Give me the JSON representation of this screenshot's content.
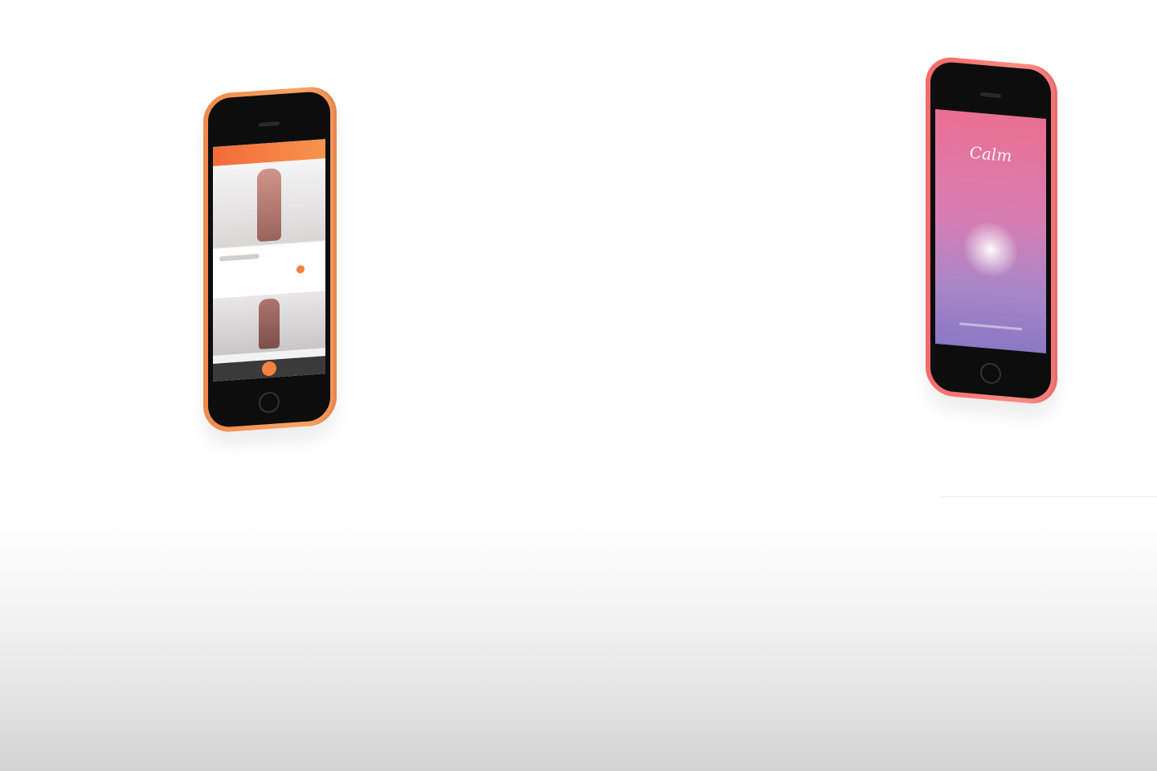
{
  "scene": {
    "phones": [
      {
        "name": "left-phone",
        "body_color": "#f7a463",
        "screen": {
          "header_color": "#f26b3a",
          "accent_color": "#f5813f"
        }
      },
      {
        "name": "right-phone",
        "body_color": "#fb8b84",
        "screen": {
          "title": "Calm",
          "gradient_top": "#ea6f92",
          "gradient_bottom": "#8b78c4"
        }
      }
    ]
  }
}
